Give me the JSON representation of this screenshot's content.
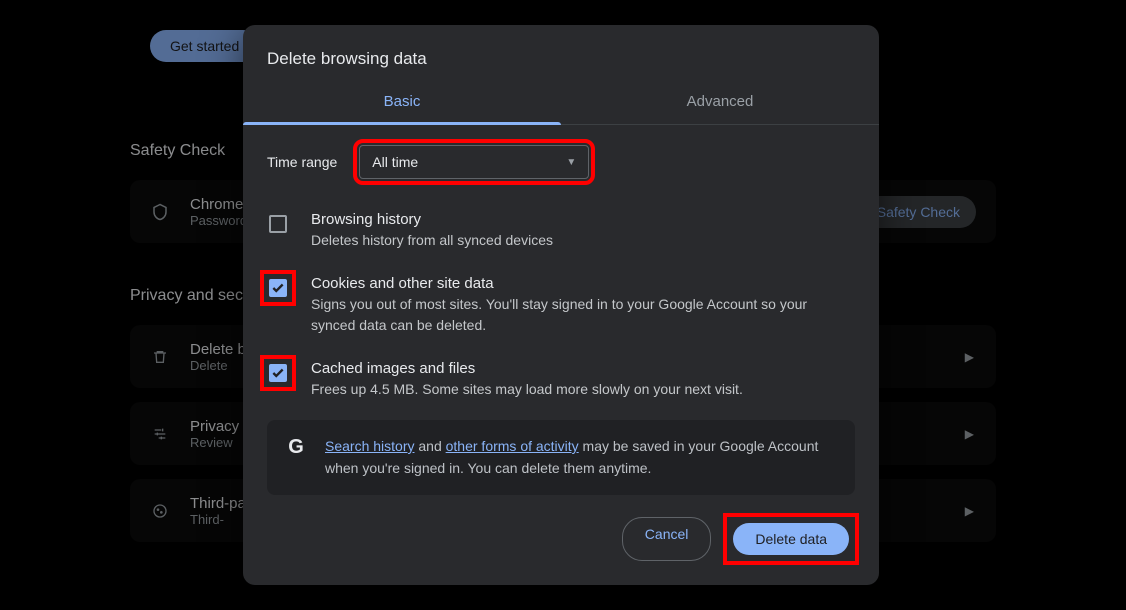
{
  "background": {
    "get_started": "Get started",
    "safety_check_heading": "Safety Check",
    "cards": {
      "chrome_any": {
        "title": "Chrome",
        "sub": "Password",
        "action": "Safety Check"
      },
      "delete": {
        "title": "Delete browsing data",
        "sub": "Delete"
      },
      "privacy_guide": {
        "title": "Privacy Guide",
        "sub": "Review"
      },
      "third_party": {
        "title": "Third-party cookies",
        "sub": "Third-"
      }
    },
    "privacy_heading": "Privacy and security"
  },
  "modal": {
    "title": "Delete browsing data",
    "tabs": {
      "basic": "Basic",
      "advanced": "Advanced"
    },
    "time_range_label": "Time range",
    "time_range_value": "All time",
    "items": {
      "history": {
        "title": "Browsing history",
        "desc": "Deletes history from all synced devices",
        "checked": false
      },
      "cookies": {
        "title": "Cookies and other site data",
        "desc": "Signs you out of most sites. You'll stay signed in to your Google Account so your synced data can be deleted.",
        "checked": true
      },
      "cache": {
        "title": "Cached images and files",
        "desc": "Frees up 4.5 MB. Some sites may load more slowly on your next visit.",
        "checked": true
      }
    },
    "info": {
      "g": "G",
      "link1": "Search history",
      "mid1": " and ",
      "link2": "other forms of activity",
      "rest": " may be saved in your Google Account when you're signed in. You can delete them anytime."
    },
    "actions": {
      "cancel": "Cancel",
      "delete": "Delete data"
    }
  }
}
